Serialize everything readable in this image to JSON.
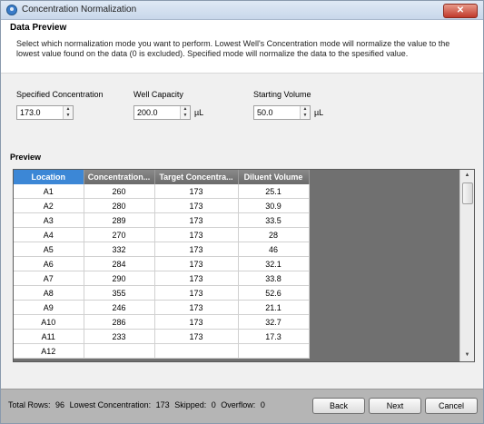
{
  "window": {
    "title": "Concentration Normalization",
    "close_label": "✕"
  },
  "header": {
    "section_title": "Data Preview",
    "description": "Select which normalization mode you want to perform. Lowest Well's Concentration mode will normalize the value to the lowest value found on the data (0 is excluded). Specified mode will normalize the data to the spesified value."
  },
  "fields": {
    "specified_concentration": {
      "label": "Specified Concentration",
      "value": "173.0"
    },
    "well_capacity": {
      "label": "Well Capacity",
      "value": "200.0",
      "unit": "µL"
    },
    "starting_volume": {
      "label": "Starting Volume",
      "value": "50.0",
      "unit": "µL"
    }
  },
  "preview": {
    "label": "Preview",
    "columns": [
      "Location",
      "Concentration...",
      "Target Concentra...",
      "Diluent Volume"
    ],
    "rows": [
      [
        "A1",
        "260",
        "173",
        "25.1"
      ],
      [
        "A2",
        "280",
        "173",
        "30.9"
      ],
      [
        "A3",
        "289",
        "173",
        "33.5"
      ],
      [
        "A4",
        "270",
        "173",
        "28"
      ],
      [
        "A5",
        "332",
        "173",
        "46"
      ],
      [
        "A6",
        "284",
        "173",
        "32.1"
      ],
      [
        "A7",
        "290",
        "173",
        "33.8"
      ],
      [
        "A8",
        "355",
        "173",
        "52.6"
      ],
      [
        "A9",
        "246",
        "173",
        "21.1"
      ],
      [
        "A10",
        "286",
        "173",
        "32.7"
      ],
      [
        "A11",
        "233",
        "173",
        "17.3"
      ],
      [
        "A12",
        "",
        "",
        ""
      ]
    ]
  },
  "footer": {
    "total_rows_label": "Total Rows:",
    "total_rows": "96",
    "lowest_label": "Lowest Concentration:",
    "lowest": "173",
    "skipped_label": "Skipped:",
    "skipped": "0",
    "overflow_label": "Overflow:",
    "overflow": "0",
    "back": "Back",
    "next": "Next",
    "cancel": "Cancel"
  }
}
